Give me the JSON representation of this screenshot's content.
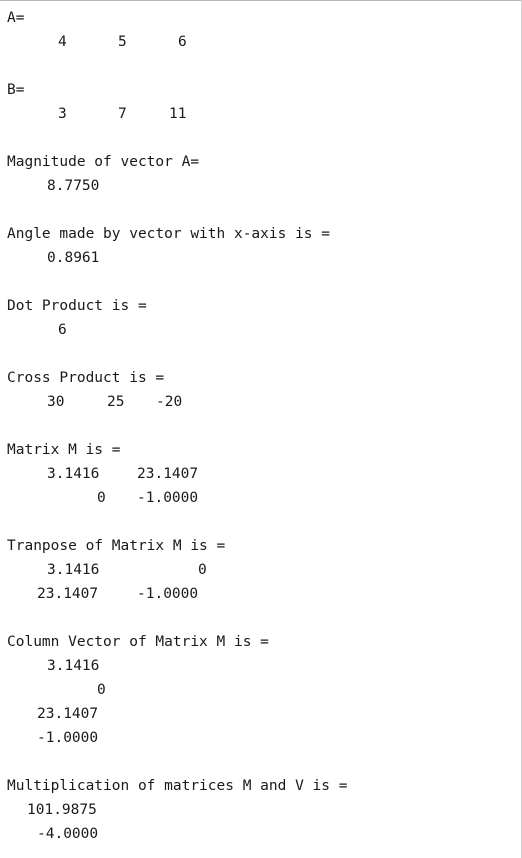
{
  "output": {
    "a_label": "A=",
    "a_values": [
      "4",
      "5",
      "6"
    ],
    "b_label": "B=",
    "b_values": [
      "3",
      "7",
      "11"
    ],
    "magnitude_label": "Magnitude of vector A=",
    "magnitude_value": "8.7750",
    "angle_label": "Angle made by vector with x-axis is =",
    "angle_value": "0.8961",
    "dot_label": "Dot Product is =",
    "dot_value": "6",
    "cross_label": "Cross Product is =",
    "cross_values": [
      "30",
      "25",
      "-20"
    ],
    "matrix_label": "Matrix M is =",
    "matrix_rows": [
      [
        "3.1416",
        "23.1407"
      ],
      [
        "0",
        "-1.0000"
      ]
    ],
    "transpose_label": "Tranpose of Matrix M is =",
    "transpose_rows": [
      [
        "3.1416",
        "0"
      ],
      [
        "23.1407",
        "-1.0000"
      ]
    ],
    "column_label": "Column Vector of Matrix M is =",
    "column_values": [
      "3.1416",
      "0",
      "23.1407",
      "-1.0000"
    ],
    "mult_label": "Multiplication of matrices M and V is =",
    "mult_values": [
      "101.9875",
      "-4.0000"
    ]
  }
}
